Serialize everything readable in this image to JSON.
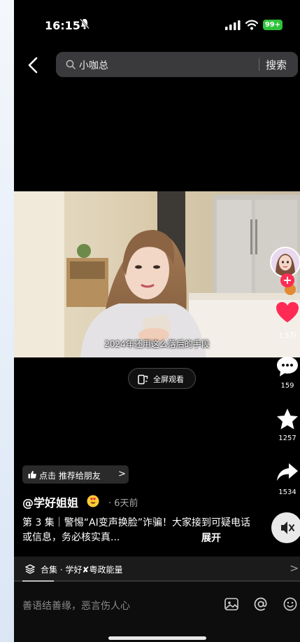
{
  "status_bar": {
    "time": "16:15",
    "battery": "99+"
  },
  "search": {
    "query": "小咖总",
    "button": "搜索"
  },
  "video": {
    "subtitle": "2024年还用这么落后的手段"
  },
  "fullscreen": {
    "label": "全屏观看"
  },
  "actions": {
    "likes": "1.5万",
    "comments": "159",
    "favorites": "1257",
    "shares": "1534"
  },
  "recommend": {
    "label": "点击 推荐给朋友",
    "chevron": ">"
  },
  "post": {
    "author": "@学好姐姐",
    "posted": "· 6天前",
    "description": "第 3 集｜警惕“AI变声换脸”诈骗！大家接到可疑电话或信息，务必核实真...",
    "more": "展开"
  },
  "collection": {
    "label": "合集 · 学好✘粤政能量",
    "chevron": ">",
    "progress": 0.11
  },
  "comment": {
    "placeholder": "善语结善缘，恶言伤人心"
  },
  "colors": {
    "background": "#000000",
    "like": "#fe2c55",
    "battery": "#2ec23b"
  },
  "icons": [
    "bell-mute-icon",
    "signal-icon",
    "wifi-icon",
    "back-icon",
    "search-icon",
    "fullscreen-icon",
    "heart-icon",
    "comment-icon",
    "star-icon",
    "share-icon",
    "mute-icon",
    "thumb-icon",
    "layers-icon",
    "image-icon",
    "at-icon",
    "emoji-icon"
  ]
}
